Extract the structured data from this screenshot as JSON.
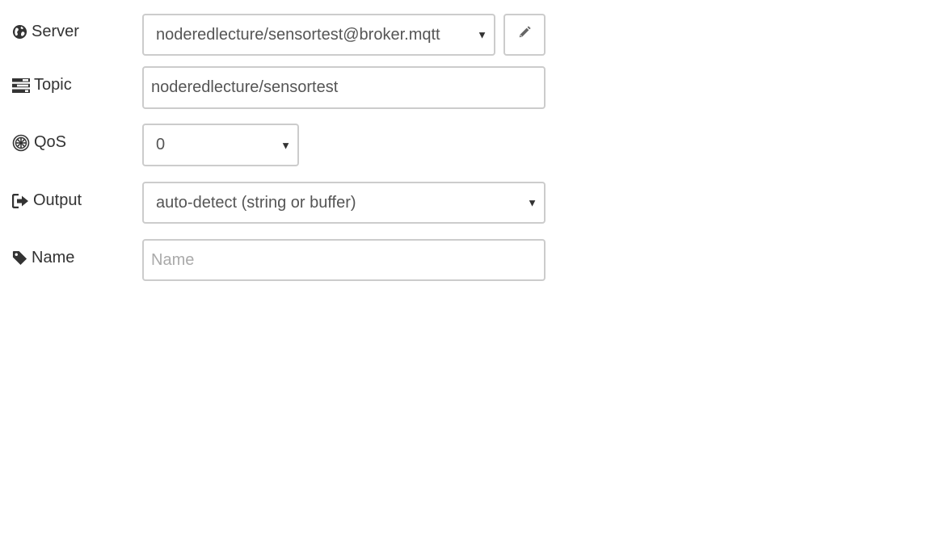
{
  "fields": {
    "server": {
      "label": "Server",
      "icon": "globe-icon",
      "value": "noderedlecture/sensortest@broker.mqtt",
      "edit_icon": "pencil-icon"
    },
    "topic": {
      "label": "Topic",
      "icon": "tasks-icon",
      "value": "noderedlecture/sensortest"
    },
    "qos": {
      "label": "QoS",
      "icon": "empire-icon",
      "value": "0"
    },
    "output": {
      "label": "Output",
      "icon": "sign-out-icon",
      "value": "auto-detect (string or buffer)"
    },
    "name": {
      "label": "Name",
      "icon": "tag-icon",
      "value": "",
      "placeholder": "Name"
    }
  },
  "colors": {
    "label_text": "#333333",
    "control_text": "#555555",
    "border": "#cccccc",
    "placeholder": "#aaaaaa"
  }
}
